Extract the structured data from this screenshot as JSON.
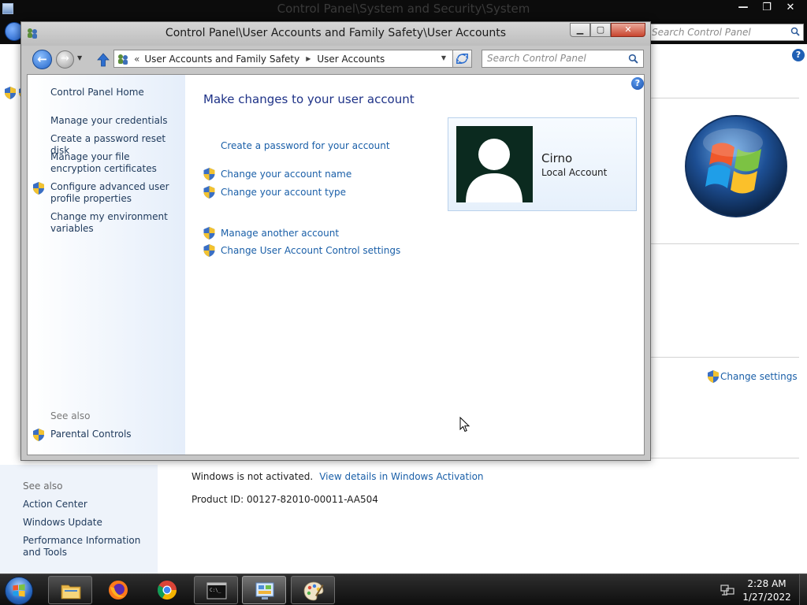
{
  "background_window": {
    "title": "Control Panel\\System and Security\\System",
    "controls": {
      "minimize": "—",
      "maximize": "❐",
      "close": "✕"
    },
    "search_placeholder": "Search Control Panel",
    "see_also_label": "See also",
    "see_also_links": [
      "Action Center",
      "Windows Update",
      "Performance Information and Tools"
    ],
    "change_settings": "Change settings",
    "activation_status": "Windows is not activated.",
    "activation_link": "View details in Windows Activation",
    "product_id": "Product ID: 00127-82010-00011-AA504"
  },
  "window": {
    "title": "Control Panel\\User Accounts and Family Safety\\User Accounts",
    "controls": {
      "minimize": "▁",
      "maximize": "▢",
      "close": "✕"
    },
    "address": {
      "overflow": "«",
      "crumbs": [
        "User Accounts and Family Safety",
        "User Accounts"
      ],
      "separator": "▶"
    },
    "search_placeholder": "Search Control Panel",
    "help": "?"
  },
  "left_nav": {
    "home": "Control Panel Home",
    "links": [
      "Manage your credentials",
      "Create a password reset disk",
      "Manage your file encryption certificates",
      "Configure advanced user profile properties",
      "Change my environment variables"
    ],
    "see_also_label": "See also",
    "see_also_links": [
      "Parental Controls"
    ]
  },
  "main": {
    "title": "Make changes to your user account",
    "tasks": [
      "Create a password for your account",
      "Change your account name",
      "Change your account type",
      "Manage another account",
      "Change User Account Control settings"
    ]
  },
  "account": {
    "name": "Cirno",
    "type": "Local Account"
  },
  "taskbar": {
    "apps": [
      "start-orb",
      "file-explorer",
      "firefox",
      "chrome",
      "command-prompt",
      "control-panel",
      "paint"
    ],
    "clock_time": "2:28 AM",
    "clock_date": "1/27/2022"
  },
  "colors": {
    "link": "#1a5fa8",
    "heading": "#1e3287",
    "nav_link": "#1e395b",
    "close_button": "#c9452e"
  }
}
